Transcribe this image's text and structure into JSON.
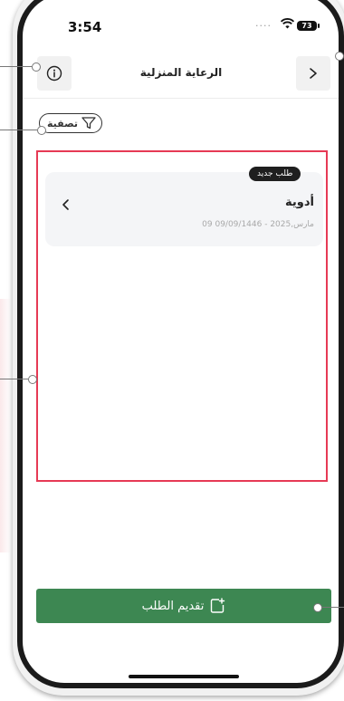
{
  "status_bar": {
    "time": "3:54",
    "battery": "73"
  },
  "header": {
    "title": "الرعاية المنزلية",
    "info_icon": "info-icon",
    "back_icon": "chevron-right-icon"
  },
  "filter": {
    "label": "تصفية",
    "icon": "filter-icon"
  },
  "requests": [
    {
      "badge": "طلب جديد",
      "title": "أدوية",
      "date": "09 مارس,2025 - 09/09/1446",
      "chevron_icon": "chevron-left-icon"
    }
  ],
  "submit_button": {
    "label": "تقديم الطلب",
    "icon": "add-document-icon"
  },
  "colors": {
    "primary_green": "#3d8752",
    "highlight_red": "#e63a55",
    "badge_dark": "#1f1f1f"
  }
}
